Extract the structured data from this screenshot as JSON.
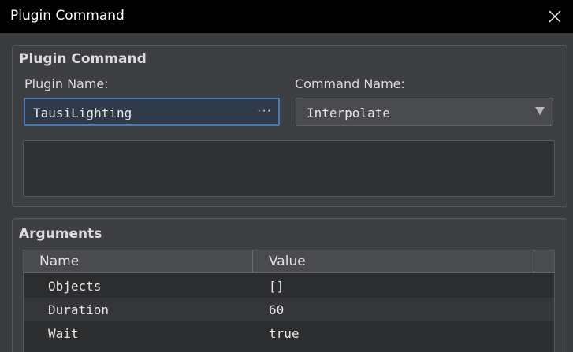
{
  "window": {
    "title": "Plugin Command"
  },
  "plugin_command_group": {
    "title": "Plugin Command",
    "plugin_name_label": "Plugin Name:",
    "plugin_name_value": "TausiLighting",
    "plugin_name_button": "···",
    "command_name_label": "Command Name:",
    "command_name_value": "Interpolate",
    "description": ""
  },
  "arguments_group": {
    "title": "Arguments",
    "columns": [
      "Name",
      "Value"
    ],
    "rows": [
      {
        "name": "Objects",
        "value": "[]"
      },
      {
        "name": "Duration",
        "value": "60"
      },
      {
        "name": "Wait",
        "value": "true"
      }
    ]
  },
  "colors": {
    "titlebar": "#000000",
    "window_bg": "#3a3b3d",
    "focus_border": "#4c7ab0"
  }
}
